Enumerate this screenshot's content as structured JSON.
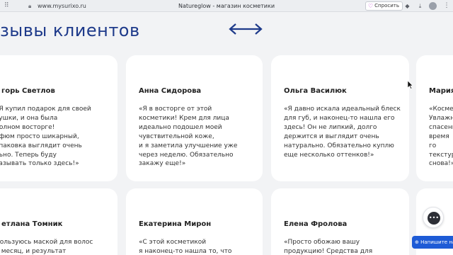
{
  "browser": {
    "url": "www.mysurixo.ru",
    "title": "Natureglow - магазин косметики",
    "ask_label": "Спросить",
    "icons": [
      "grip-icon",
      "lock-icon",
      "heart-icon",
      "camera-icon",
      "download-icon",
      "profile-icon",
      "menu-icon"
    ]
  },
  "section": {
    "heading": "зывы клиентов"
  },
  "reviews": [
    {
      "name": "горь Светлов",
      "text": "«Я купил подарок для своей\nвушки, и она была\nполном восторге!\nрфюм просто шикарный,\nупаковка выглядит очень\nльно. Теперь буду\nказывать только здесь!»"
    },
    {
      "name": "Анна Сидорова",
      "text": "«Я в восторге от этой\nкосметики! Крем для лица\nидеально подошел моей\nчувствительной коже,\nи я заметила улучшение уже\nчерез неделю. Обязательно\nзакажу еще!»"
    },
    {
      "name": "Ольга Василюк",
      "text": "«Я давно искала идеальный блеск\nдля губ, и наконец-то нашла его\nздесь! Он не липкий, долго\nдержится и выглядит очень\nнатурально. Обязательно куплю\nеще несколько оттенков!»"
    },
    {
      "name": "Мария",
      "text": "«Космети\nУвлажняю\nспасение\nвремя го\nтекстуру\nснова!»"
    },
    {
      "name": "етлана Томник",
      "text": "Пользуюсь маской для волос\nи месяц, и результат"
    },
    {
      "name": "Екатерина Мирон",
      "text": "«С этой косметикой\nя наконец-то нашла то, что"
    },
    {
      "name": "Елена Фролова",
      "text": "«Просто обожаю вашу\nпродукцию! Средства для"
    },
    {
      "name": "",
      "text": ""
    }
  ],
  "widgets": {
    "chat_label": "",
    "write_label": "Напишите нам"
  }
}
